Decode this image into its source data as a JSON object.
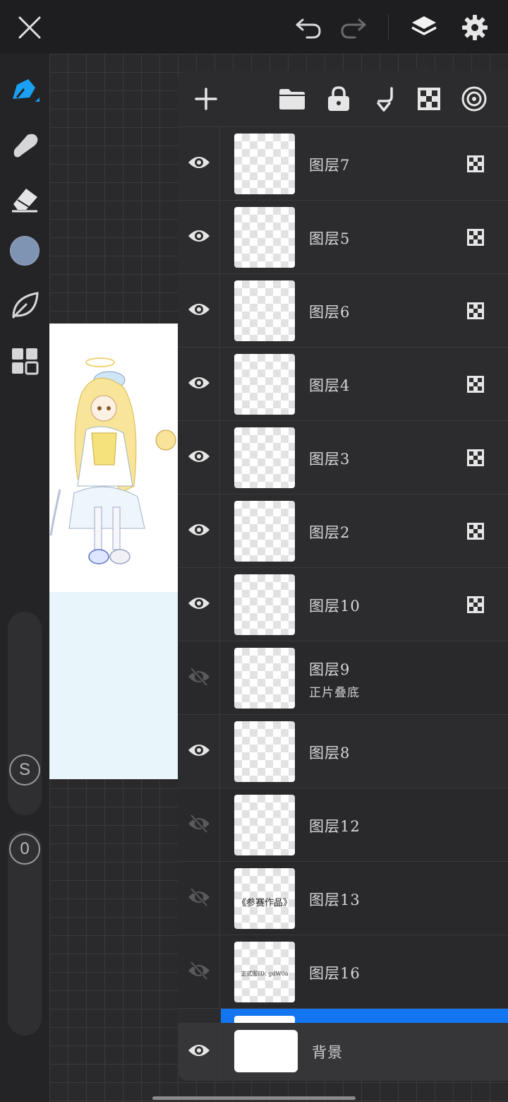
{
  "top_bar": {
    "icons": [
      "close-icon",
      "undo-icon",
      "redo-icon",
      "layers-icon",
      "settings-icon"
    ]
  },
  "left_toolbar": {
    "tools": [
      "pen-icon",
      "smudge-icon",
      "eraser-icon",
      "color-swatch",
      "leaf-icon",
      "grid-icon"
    ],
    "current_color": "#7f93b3",
    "size_slider_label": "S",
    "opacity_slider_label": "0"
  },
  "layers_panel": {
    "header_icons": [
      "add-layer-icon",
      "folder-icon",
      "lock-icon",
      "merge-down-icon",
      "alpha-lock-icon",
      "more-icon"
    ],
    "layers": [
      {
        "name": "图层7",
        "visible": true,
        "blend": "",
        "thumb_text": ""
      },
      {
        "name": "图层5",
        "visible": true,
        "blend": "",
        "thumb_text": ""
      },
      {
        "name": "图层6",
        "visible": true,
        "blend": "",
        "thumb_text": ""
      },
      {
        "name": "图层4",
        "visible": true,
        "blend": "",
        "thumb_text": ""
      },
      {
        "name": "图层3",
        "visible": true,
        "blend": "",
        "thumb_text": ""
      },
      {
        "name": "图层2",
        "visible": true,
        "blend": "",
        "thumb_text": ""
      },
      {
        "name": "图层10",
        "visible": true,
        "blend": "",
        "thumb_text": ""
      },
      {
        "name": "图层9",
        "visible": false,
        "blend": "正片叠底",
        "thumb_text": ""
      },
      {
        "name": "图层8",
        "visible": true,
        "blend": "",
        "thumb_text": ""
      },
      {
        "name": "图层12",
        "visible": false,
        "blend": "",
        "thumb_text": ""
      },
      {
        "name": "图层13",
        "visible": false,
        "blend": "",
        "thumb_text": "《参赛作品》"
      },
      {
        "name": "图层16",
        "visible": false,
        "blend": "",
        "thumb_text": "正式服ID: gdW0a"
      }
    ],
    "background_layer": {
      "name": "背景",
      "visible": true
    },
    "selection_color": "#1376f0"
  }
}
